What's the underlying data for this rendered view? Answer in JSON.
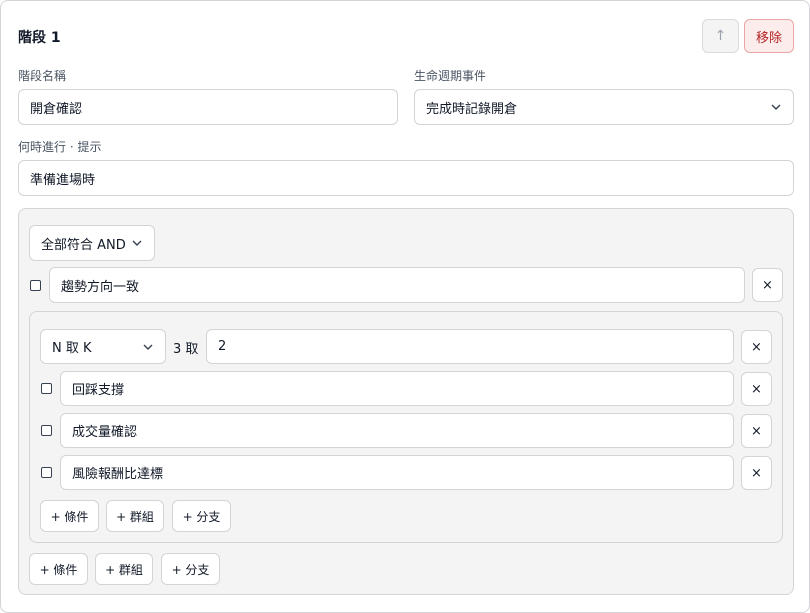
{
  "stage": {
    "title": "階段 1",
    "up_icon": "↑",
    "remove_label": "移除",
    "name_label": "階段名稱",
    "name_value": "開倉確認",
    "lifecycle_label": "生命週期事件",
    "lifecycle_value": "完成時記錄開倉",
    "hint_label": "何時進行 · 提示",
    "hint_value": "準備進場時"
  },
  "outer_group": {
    "mode_value": "全部符合 AND",
    "conditions": [
      {
        "text": "趨勢方向一致"
      }
    ],
    "nested_group": {
      "mode_value": "N 取 K",
      "n_text": "3 取",
      "k_value": "2",
      "conditions": [
        {
          "text": "回踩支撐"
        },
        {
          "text": "成交量確認"
        },
        {
          "text": "風險報酬比達標"
        }
      ],
      "add_condition": "+ 條件",
      "add_group": "+ 群組",
      "add_branch": "+ 分支"
    },
    "add_condition": "+ 條件",
    "add_group": "+ 群組",
    "add_branch": "+ 分支"
  },
  "icons": {
    "close": "×",
    "chevron": "chevron-down-icon"
  }
}
